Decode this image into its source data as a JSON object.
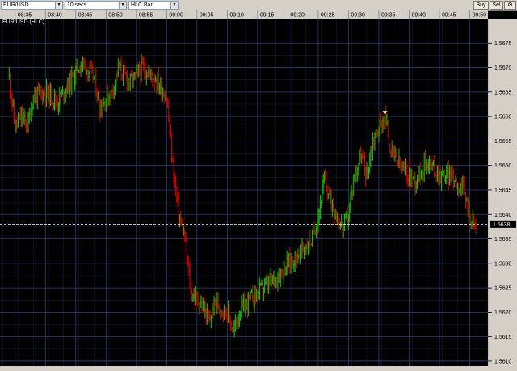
{
  "toolbar": {
    "symbol": "EUR/USD",
    "interval": "10 secs",
    "chart_style": "HLC Bar",
    "buy_label": "Buy",
    "sell_label": "Sel",
    "settings_glyph": "⚙"
  },
  "chart_title": "EUR/USD (HLC)",
  "time_labels": [
    "08:35",
    "08:40",
    "08:45",
    "08:50",
    "08:55",
    "09:00",
    "09:05",
    "09:10",
    "09:15",
    "09:20",
    "09:25",
    "09:30",
    "09:35",
    "09:40",
    "09:45",
    "09:50"
  ],
  "price_labels": [
    "1.5675",
    "1.5670",
    "1.5665",
    "1.5660",
    "1.5655",
    "1.5650",
    "1.5645",
    "1.5640",
    "1.5635",
    "1.5630",
    "1.5625",
    "1.5620",
    "1.5615",
    "1.5610"
  ],
  "current_price": "1.5638",
  "colors": {
    "up": "#00d000",
    "down": "#e00000",
    "grid": "#2e3f7a",
    "axis_bg": "#d4d0c8"
  },
  "chart_data": {
    "type": "bar",
    "style": "HLC",
    "x_unit": "time",
    "ylim": [
      1.5609,
      1.568
    ],
    "grid": true,
    "last_price": 1.5638,
    "marker": {
      "time": "09:36",
      "price": 1.566,
      "shape": "triangle-down"
    },
    "approx_path": [
      [
        "08:34",
        1.5668
      ],
      [
        "08:35",
        1.5658
      ],
      [
        "08:36",
        1.566
      ],
      [
        "08:37",
        1.5658
      ],
      [
        "08:38",
        1.5664
      ],
      [
        "08:40",
        1.5665
      ],
      [
        "08:42",
        1.5663
      ],
      [
        "08:44",
        1.5667
      ],
      [
        "08:46",
        1.5671
      ],
      [
        "08:48",
        1.5668
      ],
      [
        "08:49",
        1.5662
      ],
      [
        "08:51",
        1.5665
      ],
      [
        "08:52",
        1.567
      ],
      [
        "08:54",
        1.5667
      ],
      [
        "08:56",
        1.567
      ],
      [
        "08:58",
        1.5668
      ],
      [
        "09:00",
        1.5664
      ],
      [
        "09:01",
        1.565
      ],
      [
        "09:02",
        1.564
      ],
      [
        "09:03",
        1.5635
      ],
      [
        "09:04",
        1.5624
      ],
      [
        "09:06",
        1.5621
      ],
      [
        "09:07",
        1.5618
      ],
      [
        "09:08",
        1.5622
      ],
      [
        "09:10",
        1.562
      ],
      [
        "09:11",
        1.5616
      ],
      [
        "09:12",
        1.562
      ],
      [
        "09:14",
        1.5623
      ],
      [
        "09:16",
        1.5625
      ],
      [
        "09:18",
        1.5627
      ],
      [
        "09:20",
        1.563
      ],
      [
        "09:22",
        1.5632
      ],
      [
        "09:24",
        1.5635
      ],
      [
        "09:25",
        1.564
      ],
      [
        "09:26",
        1.5647
      ],
      [
        "09:27",
        1.5643
      ],
      [
        "09:28",
        1.564
      ],
      [
        "09:29",
        1.5637
      ],
      [
        "09:30",
        1.564
      ],
      [
        "09:31",
        1.5648
      ],
      [
        "09:32",
        1.5652
      ],
      [
        "09:33",
        1.5648
      ],
      [
        "09:34",
        1.5655
      ],
      [
        "09:36",
        1.566
      ],
      [
        "09:37",
        1.5653
      ],
      [
        "09:39",
        1.5649
      ],
      [
        "09:41",
        1.5647
      ],
      [
        "09:43",
        1.5651
      ],
      [
        "09:45",
        1.5648
      ],
      [
        "09:47",
        1.5648
      ],
      [
        "09:49",
        1.5645
      ],
      [
        "09:50",
        1.564
      ],
      [
        "09:51",
        1.5637
      ]
    ]
  }
}
